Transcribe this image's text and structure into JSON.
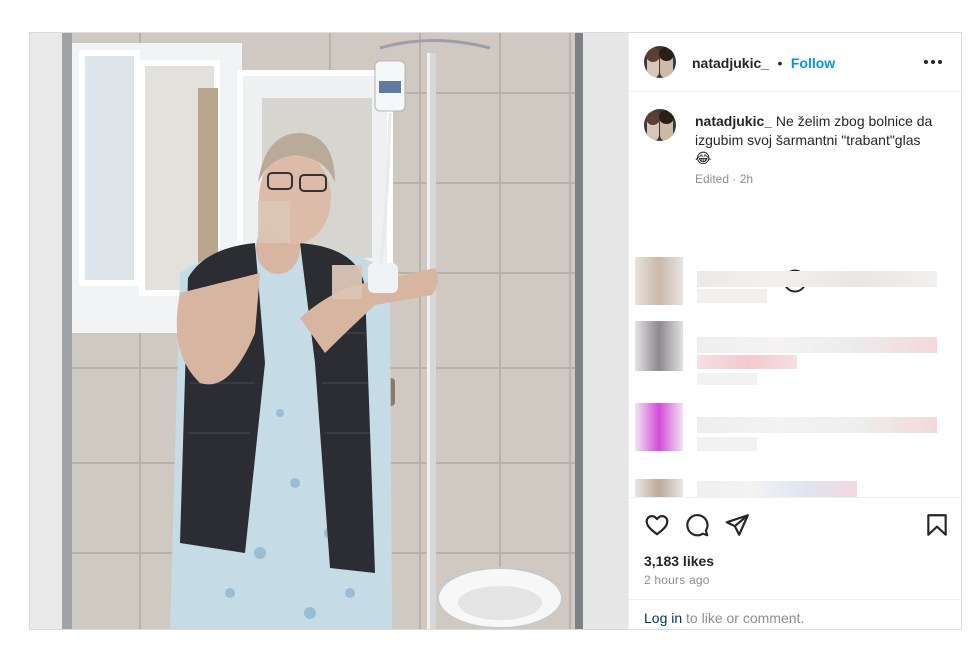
{
  "post": {
    "username": "natadjukic_",
    "separator": "•",
    "follow_label": "Follow",
    "more_icon": "more-horizontal-icon"
  },
  "caption": {
    "username": "natadjukic_",
    "text": "Ne želim zbog bolnice da izgubim svoj šarmantni \"trabant\"glas",
    "emoji": "😂",
    "meta": "Edited · 2h"
  },
  "icons": {
    "add_comment": "plus-circle-icon",
    "like": "heart-icon",
    "comment": "comment-icon",
    "share": "send-icon",
    "save": "bookmark-icon"
  },
  "stats": {
    "likes": "3,183 likes",
    "time_ago": "2 hours ago"
  },
  "footer": {
    "login_link": "Log in",
    "login_suffix": " to like or comment."
  },
  "colors": {
    "accent": "#0095f6",
    "link_dark": "#00376b",
    "muted": "#8e8e8e",
    "text": "#262626"
  }
}
